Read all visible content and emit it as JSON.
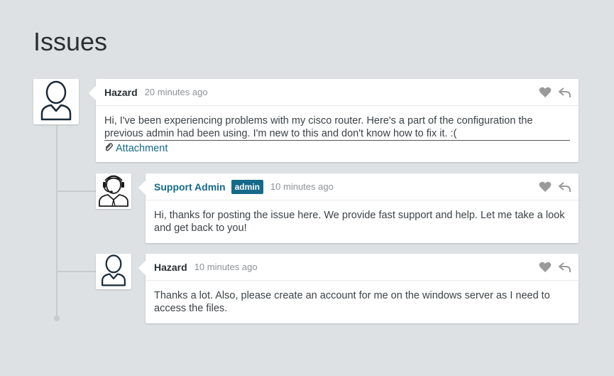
{
  "page": {
    "title": "Issues"
  },
  "comments": [
    {
      "author": "Hazard",
      "badge": "",
      "time": "20 minutes ago",
      "text": "Hi, I've been experiencing problems with my cisco router. Here's a part of the configuration the previous admin had been using. I'm new to this and don't know how to fix it. :(",
      "attachment_label": "Attachment",
      "avatar": "user-outline-icon"
    },
    {
      "author": "Support Admin",
      "badge": "admin",
      "time": "10 minutes ago",
      "text": "Hi, thanks for posting the issue here. We provide fast support and help. Let me take a look and get back to you!",
      "avatar": "support-agent-headset-icon"
    },
    {
      "author": "Hazard",
      "badge": "",
      "time": "10 minutes ago",
      "text": "Thanks a lot. Also, please create an account for me on the windows server as I need to access the files.",
      "avatar": "user-outline-icon"
    }
  ],
  "colors": {
    "background": "#dee1e4",
    "accent": "#156a8a",
    "action_icon": "#9a9a9a"
  }
}
